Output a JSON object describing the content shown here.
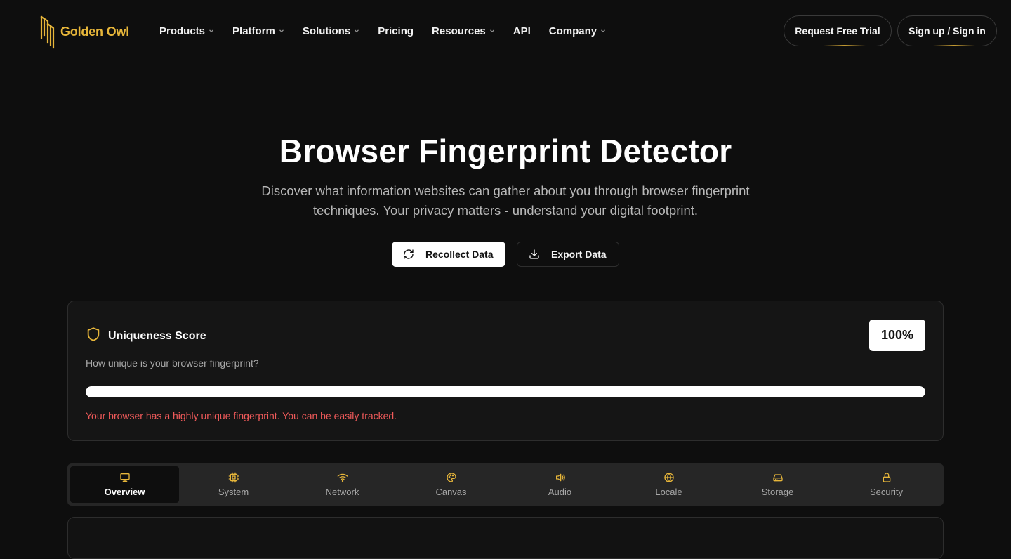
{
  "brand": {
    "name": "Golden Owl",
    "accent": "#e7b63a"
  },
  "nav": [
    {
      "label": "Products",
      "dropdown": true
    },
    {
      "label": "Platform",
      "dropdown": true
    },
    {
      "label": "Solutions",
      "dropdown": true
    },
    {
      "label": "Pricing",
      "dropdown": false
    },
    {
      "label": "Resources",
      "dropdown": true
    },
    {
      "label": "API",
      "dropdown": false
    },
    {
      "label": "Company",
      "dropdown": true
    }
  ],
  "header_buttons": {
    "trial": "Request Free Trial",
    "sign": "Sign up / Sign in"
  },
  "hero": {
    "title": "Browser Fingerprint Detector",
    "subtitle": "Discover what information websites can gather about you through browser fingerprint techniques. Your privacy matters - understand your digital footprint."
  },
  "actions": {
    "recollect": "Recollect Data",
    "export": "Export Data"
  },
  "uniqueness": {
    "title": "Uniqueness Score",
    "description": "How unique is your browser fingerprint?",
    "score_label": "100%",
    "score_value": 100,
    "warning": "Your browser has a highly unique fingerprint. You can be easily tracked.",
    "warning_color": "#ef5a5a",
    "icon": "shield-icon"
  },
  "tabs": [
    {
      "label": "Overview",
      "icon": "monitor-icon",
      "active": true
    },
    {
      "label": "System",
      "icon": "cpu-icon",
      "active": false
    },
    {
      "label": "Network",
      "icon": "wifi-icon",
      "active": false
    },
    {
      "label": "Canvas",
      "icon": "palette-icon",
      "active": false
    },
    {
      "label": "Audio",
      "icon": "speaker-icon",
      "active": false
    },
    {
      "label": "Locale",
      "icon": "globe-icon",
      "active": false
    },
    {
      "label": "Storage",
      "icon": "hard-drive-icon",
      "active": false
    },
    {
      "label": "Security",
      "icon": "lock-icon",
      "active": false
    }
  ]
}
